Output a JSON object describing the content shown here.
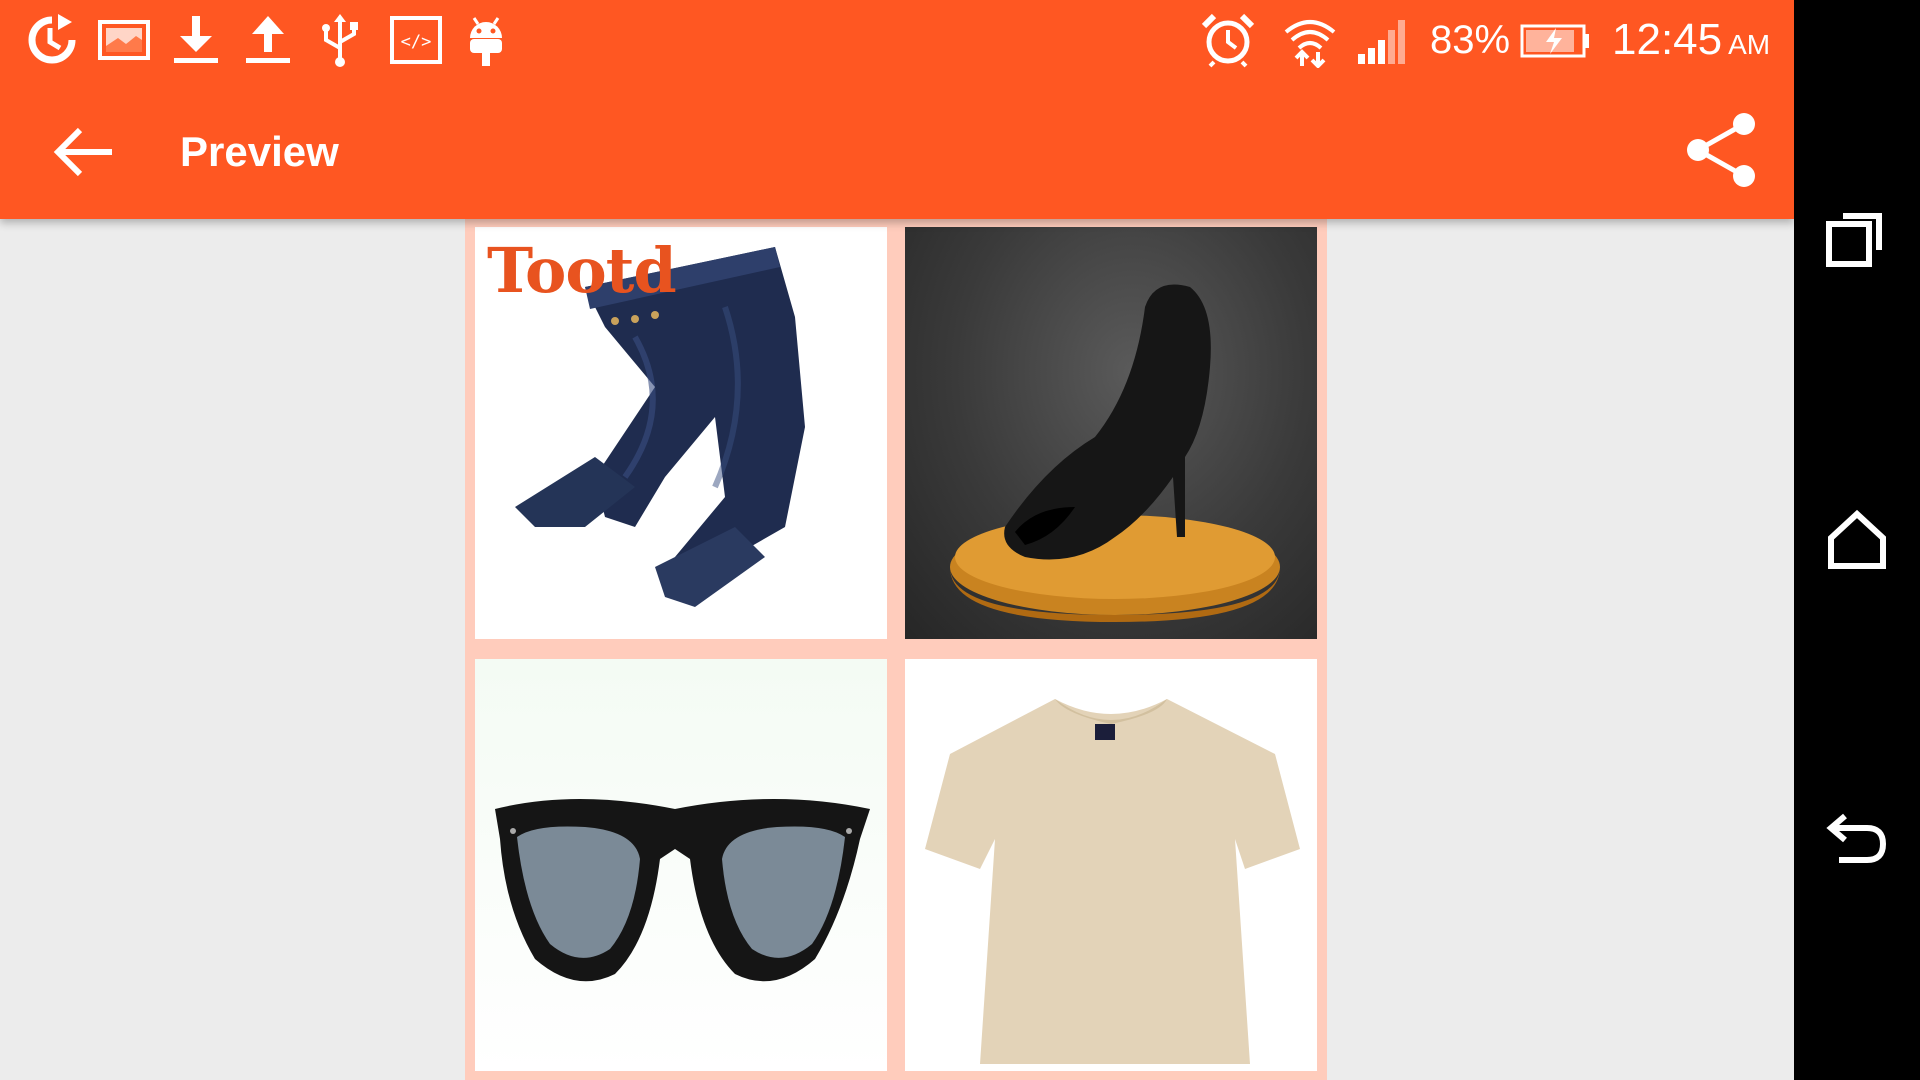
{
  "status_bar": {
    "icons": [
      "sync-icon",
      "image-icon",
      "download-icon",
      "upload-icon",
      "usb-icon",
      "code-icon",
      "android-icon"
    ],
    "right_icons": [
      "alarm-icon",
      "wifi-icon",
      "signal-icon",
      "battery-charging-icon"
    ],
    "battery": "83%",
    "time": "12:45",
    "ampm": "AM"
  },
  "toolbar": {
    "title": "Preview",
    "back_icon": "arrow-back-icon",
    "share_icon": "share-icon"
  },
  "collage": {
    "watermark": "Tootd",
    "items": [
      {
        "name": "jeans",
        "icon": "jeans-image"
      },
      {
        "name": "heel",
        "icon": "high-heel-image"
      },
      {
        "name": "sunglasses",
        "icon": "sunglasses-image"
      },
      {
        "name": "tshirt",
        "icon": "tshirt-image"
      }
    ]
  },
  "navigation": {
    "buttons": [
      "recents-icon",
      "home-icon",
      "back-icon"
    ]
  },
  "colors": {
    "primary": "#ff5722",
    "collage_border": "#ffccbc",
    "background": "#ececec",
    "navbar": "#000000"
  }
}
